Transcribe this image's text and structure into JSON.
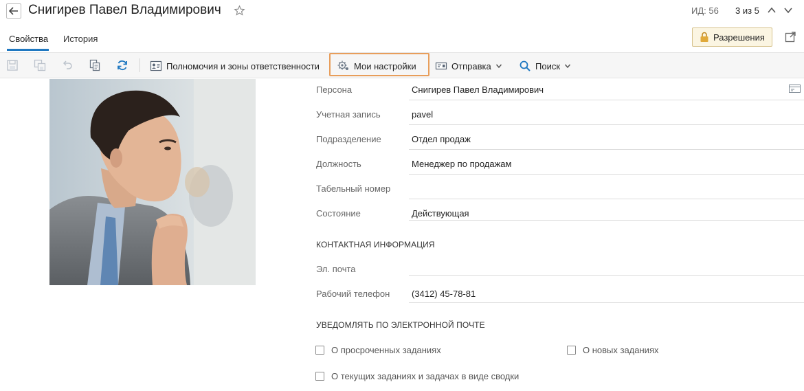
{
  "header": {
    "title": "Снигирев Павел Владимирович",
    "id_label": "ИД: 56",
    "pager": "3 из 5"
  },
  "tabs": [
    {
      "label": "Свойства",
      "active": true
    },
    {
      "label": "История",
      "active": false
    }
  ],
  "permissions_button": "Разрешения",
  "toolbar": {
    "responsibilities": "Полномочия и зоны ответственности",
    "my_settings": "Мои настройки",
    "send": "Отправка",
    "search": "Поиск"
  },
  "fields": [
    {
      "label": "Персона",
      "value": "Снигирев Павел Владимирович"
    },
    {
      "label": "Учетная запись",
      "value": "pavel"
    },
    {
      "label": "Подразделение",
      "value": "Отдел продаж"
    },
    {
      "label": "Должность",
      "value": "Менеджер по продажам"
    },
    {
      "label": "Табельный номер",
      "value": ""
    },
    {
      "label": "Состояние",
      "value": "Действующая"
    }
  ],
  "contact": {
    "heading": "КОНТАКТНАЯ ИНФОРМАЦИЯ",
    "email_label": "Эл. почта",
    "email_value": "",
    "phone_label": "Рабочий телефон",
    "phone_value": "(3412) 45-78-81"
  },
  "notify": {
    "heading": "УВЕДОМЛЯТЬ ПО ЭЛЕКТРОННОЙ ПОЧТЕ",
    "options": [
      {
        "label": "О просроченных заданиях",
        "checked": false
      },
      {
        "label": "О новых заданиях",
        "checked": false
      },
      {
        "label": "О текущих заданиях и задачах в виде сводки",
        "checked": false
      }
    ]
  },
  "colors": {
    "accent": "#1f78c1",
    "highlight_border": "#e89e5b",
    "permission_bg": "#fbf5e2"
  }
}
